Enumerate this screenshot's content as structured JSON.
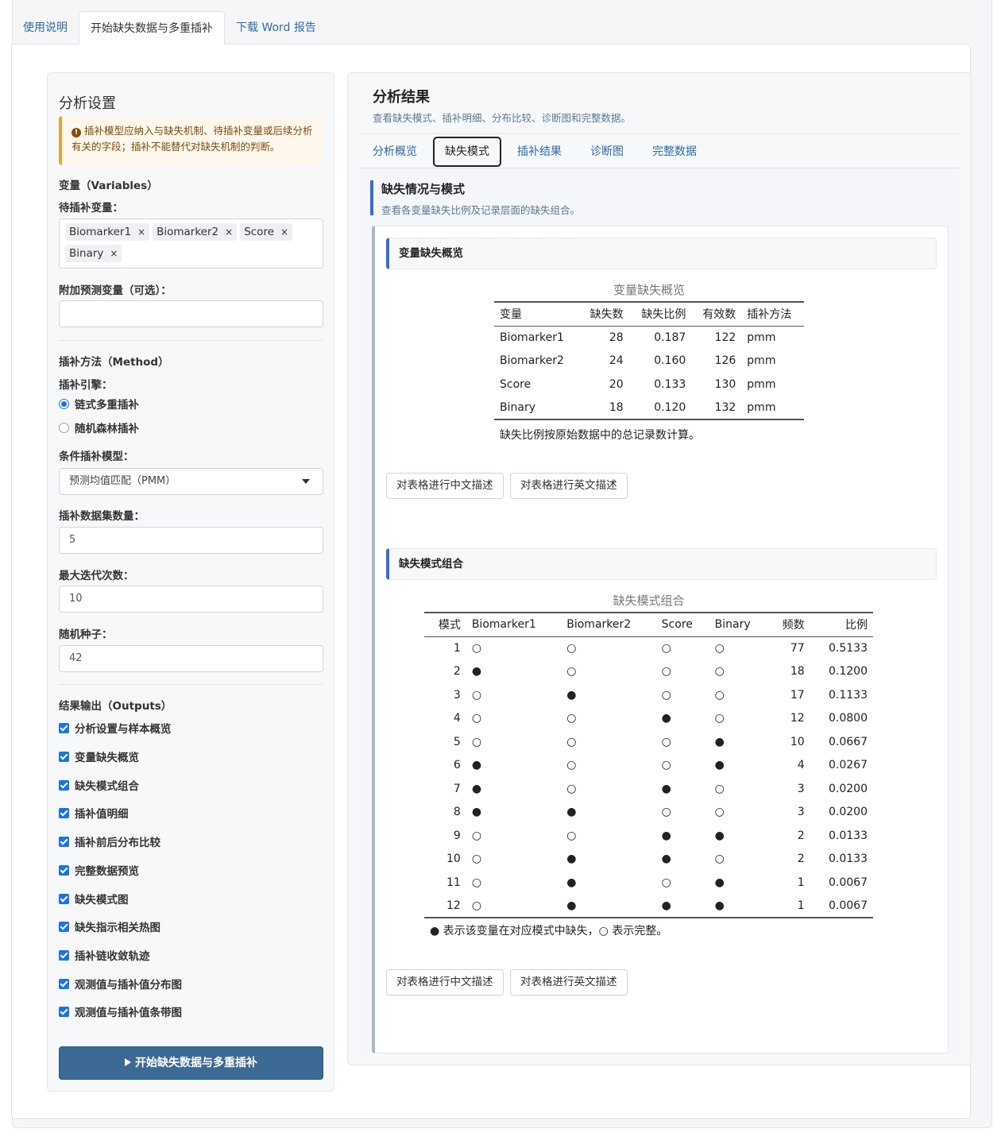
{
  "top_tabs": [
    {
      "label": "使用说明",
      "active": false
    },
    {
      "label": "开始缺失数据与多重插补",
      "active": true
    },
    {
      "label": "下载 Word 报告",
      "active": false
    }
  ],
  "sidebar": {
    "title": "分析设置",
    "alert": "插补模型应纳入与缺失机制、待插补变量或后续分析有关的字段；插补不能替代对缺失机制的判断。",
    "variables_section": "变量（Variables）",
    "impute_vars_label": "待插补变量：",
    "impute_vars": [
      "Biomarker1",
      "Biomarker2",
      "Score",
      "Binary"
    ],
    "extra_predictors_label": "附加预测变量（可选）：",
    "extra_predictors_value": "",
    "method_section": "插补方法（Method）",
    "engine_label": "插补引擎：",
    "engines": [
      {
        "label": "链式多重插补",
        "selected": true
      },
      {
        "label": "随机森林插补",
        "selected": false
      }
    ],
    "cond_model_label": "条件插补模型：",
    "cond_model_value": "预测均值匹配（PMM）",
    "num_datasets_label": "插补数据集数量：",
    "num_datasets_value": "5",
    "max_iter_label": "最大迭代次数：",
    "max_iter_value": "10",
    "seed_label": "随机种子：",
    "seed_value": "42",
    "outputs_section": "结果输出（Outputs）",
    "outputs": [
      {
        "label": "分析设置与样本概览",
        "checked": true
      },
      {
        "label": "变量缺失概览",
        "checked": true
      },
      {
        "label": "缺失模式组合",
        "checked": true
      },
      {
        "label": "插补值明细",
        "checked": true
      },
      {
        "label": "插补前后分布比较",
        "checked": true
      },
      {
        "label": "完整数据预览",
        "checked": true
      },
      {
        "label": "缺失模式图",
        "checked": true
      },
      {
        "label": "缺失指示相关热图",
        "checked": true
      },
      {
        "label": "插补链收敛轨迹",
        "checked": true
      },
      {
        "label": "观测值与插补值分布图",
        "checked": true
      },
      {
        "label": "观测值与插补值条带图",
        "checked": true
      }
    ],
    "run_button": "开始缺失数据与多重插补"
  },
  "main": {
    "title": "分析结果",
    "subtitle": "查看缺失模式、插补明细、分布比较、诊断图和完整数据。",
    "tabs": [
      {
        "label": "分析概览",
        "active": false
      },
      {
        "label": "缺失模式",
        "active": true
      },
      {
        "label": "插补结果",
        "active": false
      },
      {
        "label": "诊断图",
        "active": false
      },
      {
        "label": "完整数据",
        "active": false
      }
    ],
    "section_title": "缺失情况与模式",
    "section_subtitle": "查看各变量缺失比例及记录层面的缺失组合。",
    "card1": {
      "header": "变量缺失概览",
      "caption": "变量缺失概览",
      "columns": [
        "变量",
        "缺失数",
        "缺失比例",
        "有效数",
        "插补方法"
      ],
      "rows": [
        [
          "Biomarker1",
          "28",
          "0.187",
          "122",
          "pmm"
        ],
        [
          "Biomarker2",
          "24",
          "0.160",
          "126",
          "pmm"
        ],
        [
          "Score",
          "20",
          "0.133",
          "130",
          "pmm"
        ],
        [
          "Binary",
          "18",
          "0.120",
          "132",
          "pmm"
        ]
      ],
      "note": "缺失比例按原始数据中的总记录数计算。",
      "btn_cn": "对表格进行中文描述",
      "btn_en": "对表格进行英文描述"
    },
    "card2": {
      "header": "缺失模式组合",
      "caption": "缺失模式组合",
      "columns": [
        "模式",
        "Biomarker1",
        "Biomarker2",
        "Score",
        "Binary",
        "频数",
        "比例"
      ],
      "rows": [
        [
          "1",
          "○",
          "○",
          "○",
          "○",
          "77",
          "0.5133"
        ],
        [
          "2",
          "●",
          "○",
          "○",
          "○",
          "18",
          "0.1200"
        ],
        [
          "3",
          "○",
          "●",
          "○",
          "○",
          "17",
          "0.1133"
        ],
        [
          "4",
          "○",
          "○",
          "●",
          "○",
          "12",
          "0.0800"
        ],
        [
          "5",
          "○",
          "○",
          "○",
          "●",
          "10",
          "0.0667"
        ],
        [
          "6",
          "●",
          "○",
          "○",
          "●",
          "4",
          "0.0267"
        ],
        [
          "7",
          "●",
          "○",
          "●",
          "○",
          "3",
          "0.0200"
        ],
        [
          "8",
          "●",
          "●",
          "○",
          "○",
          "3",
          "0.0200"
        ],
        [
          "9",
          "○",
          "○",
          "●",
          "●",
          "2",
          "0.0133"
        ],
        [
          "10",
          "○",
          "●",
          "●",
          "○",
          "2",
          "0.0133"
        ],
        [
          "11",
          "○",
          "●",
          "○",
          "●",
          "1",
          "0.0067"
        ],
        [
          "12",
          "○",
          "●",
          "●",
          "●",
          "1",
          "0.0067"
        ]
      ],
      "note": "● 表示该变量在对应模式中缺失，○ 表示完整。",
      "btn_cn": "对表格进行中文描述",
      "btn_en": "对表格进行英文描述"
    }
  }
}
